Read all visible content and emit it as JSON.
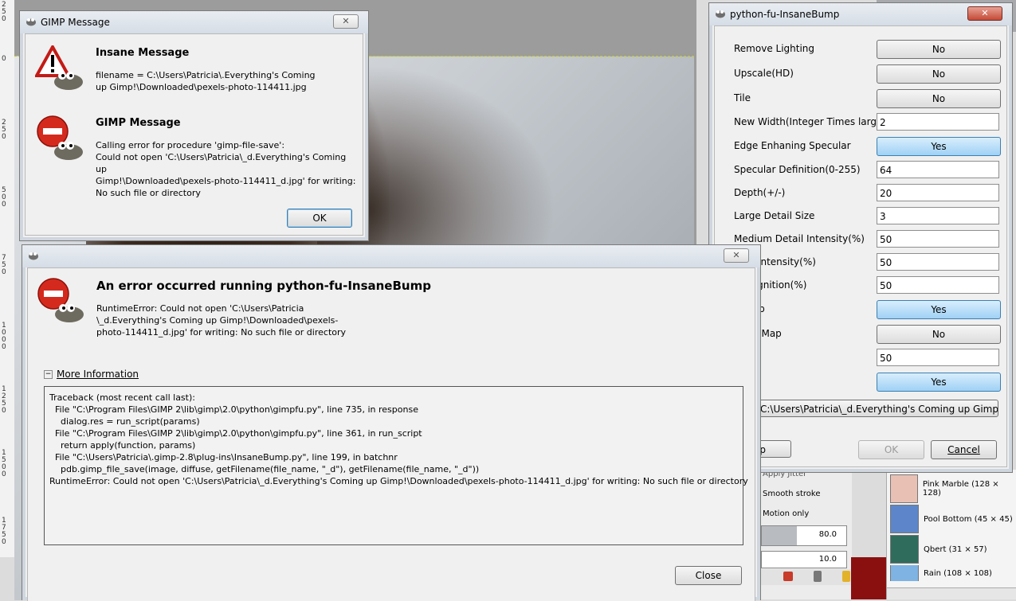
{
  "gimp_message": {
    "title": "GIMP Message",
    "close": "✕",
    "insane_heading": "Insane Message",
    "insane_text": "filename = C:\\Users\\Patricia\\.Everything's Coming\nup Gimp!\\Downloaded\\pexels-photo-114411.jpg",
    "gimp_heading": "GIMP Message",
    "gimp_text": "Calling error for procedure 'gimp-file-save':\nCould not open 'C:\\Users\\Patricia\\_d.Everything's Coming up\nGimp!\\Downloaded\\pexels-photo-114411_d.jpg' for writing:\nNo such file or directory",
    "ok": "OK"
  },
  "error_dialog": {
    "close": "✕",
    "heading": "An error occurred running python-fu-InsaneBump",
    "message": "RuntimeError: Could not open 'C:\\Users\\Patricia\n\\_d.Everything's Coming up Gimp!\\Downloaded\\pexels-\nphoto-114411_d.jpg' for writing: No such file or directory",
    "expander": "More Information",
    "traceback": "Traceback (most recent call last):\n  File \"C:\\Program Files\\GIMP 2\\lib\\gimp\\2.0\\python\\gimpfu.py\", line 735, in response\n    dialog.res = run_script(params)\n  File \"C:\\Program Files\\GIMP 2\\lib\\gimp\\2.0\\python\\gimpfu.py\", line 361, in run_script\n    return apply(function, params)\n  File \"C:\\Users\\Patricia\\.gimp-2.8\\plug-ins\\InsaneBump.py\", line 199, in batchnr\n    pdb.gimp_file_save(image, diffuse, getFilename(file_name, \"_d\"), getFilename(file_name, \"_d\"))\nRuntimeError: Could not open 'C:\\Users\\Patricia\\_d.Everything's Coming up Gimp!\\Downloaded\\pexels-photo-114411_d.jpg' for writing: No such file or directory",
    "close_button": "Close"
  },
  "insanebump": {
    "title": "python-fu-InsaneBump",
    "close": "✕",
    "fields": [
      {
        "label": "Remove Lighting",
        "value": "No",
        "kind": "toggle"
      },
      {
        "label": "Upscale(HD)",
        "value": "No",
        "kind": "toggle"
      },
      {
        "label": "Tile",
        "value": "No",
        "kind": "toggle"
      },
      {
        "label": "New Width(Integer Times larger)",
        "value": "2",
        "kind": "entry"
      },
      {
        "label": "Edge Enhaning Specular",
        "value": "Yes",
        "kind": "toggle"
      },
      {
        "label": "Specular Definition(0-255)",
        "value": "64",
        "kind": "entry"
      },
      {
        "label": "Depth(+/-)",
        "value": "20",
        "kind": "entry"
      },
      {
        "label": "Large Detail Size",
        "value": "3",
        "kind": "entry"
      },
      {
        "label": "Medium Detail Intensity(%)",
        "value": "50",
        "kind": "entry"
      },
      {
        "label": "etail Intensity(%)",
        "value": "50",
        "kind": "entry"
      },
      {
        "label": "Recognition(%)",
        "value": "50",
        "kind": "entry"
      },
      {
        "label": "n Step",
        "value": "Yes",
        "kind": "toggle"
      },
      {
        "label": "eight Map",
        "value": "No",
        "kind": "toggle"
      },
      {
        "label": "",
        "value": "50",
        "kind": "entry"
      },
      {
        "label": "",
        "value": "Yes",
        "kind": "toggle"
      }
    ],
    "file_button": "C:\\Users\\Patricia\\_d.Everything's Coming up Gimp!\\Do...",
    "help_button": "lp",
    "ok_button": "OK",
    "cancel_button": "Cancel"
  },
  "dock": {
    "apply_jitter": "Apply Jitter",
    "smooth_stroke": "Smooth stroke",
    "motion_only": "Motion only",
    "val1": "80.0",
    "val2": "10.0",
    "patterns": [
      {
        "name": "Pink Marble (128 × 128)",
        "color": "#e8c0b4"
      },
      {
        "name": "Pool Bottom (45 × 45)",
        "color": "#5c86c9"
      },
      {
        "name": "Qbert (31 × 57)",
        "color": "#2f6c5c"
      },
      {
        "name": "Rain (108 × 108)",
        "color": "#7fb3e3"
      }
    ]
  },
  "ruler": {
    "labels": [
      "250",
      "0",
      "250",
      "500",
      "750",
      "1000",
      "1250",
      "1500",
      "1750"
    ]
  }
}
